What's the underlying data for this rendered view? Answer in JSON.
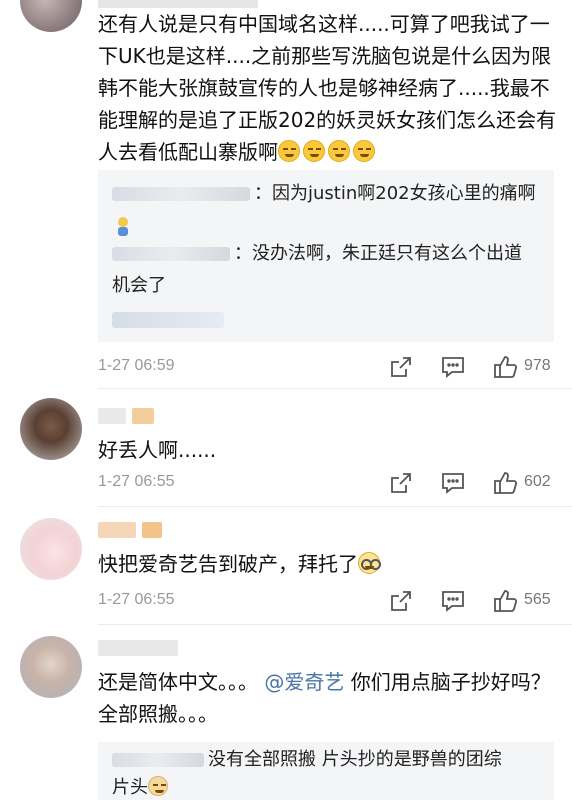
{
  "comments": [
    {
      "text": "还有人说是只有中国域名这样.....可算了吧我试了一下UK也是这样....之前那些写洗脑包说是什么因为限韩不能大张旗鼓宣传的人也是够神经病了.....我最不能理解的是追了正版202的妖灵妖女孩们怎么还会有人去看低配山寨版啊",
      "replies": [
        {
          "text": "：因为justin啊202女孩心里的痛啊"
        },
        {
          "text": "：没办法啊，朱正廷只有这么个出道机会了",
          "text_line1": "：没办法啊，朱正廷只有这么个出道",
          "text_line2": "机会了"
        }
      ],
      "time": "1-27 06:59",
      "likes": "978"
    },
    {
      "text": "好丢人啊......",
      "time": "1-27 06:55",
      "likes": "602"
    },
    {
      "text": "快把爱奇艺告到破产，拜托了",
      "time": "1-27 06:55",
      "likes": "565"
    },
    {
      "text_pre": "还是简体中文。。。",
      "mention": "@爱奇艺",
      "text_post": "你们用点脑子抄好吗？全部照搬。。。",
      "replies": [
        {
          "text_line1": "没有全部照搬 片头抄的是野兽的团综",
          "text_line2": "片头"
        }
      ]
    }
  ],
  "icons": {
    "share": "share-icon",
    "comment": "comment-icon",
    "like": "thumbs-up-icon"
  },
  "colors": {
    "mention": "#4a74a8",
    "reply_bg": "#f4f5f7",
    "meta": "#999999"
  }
}
